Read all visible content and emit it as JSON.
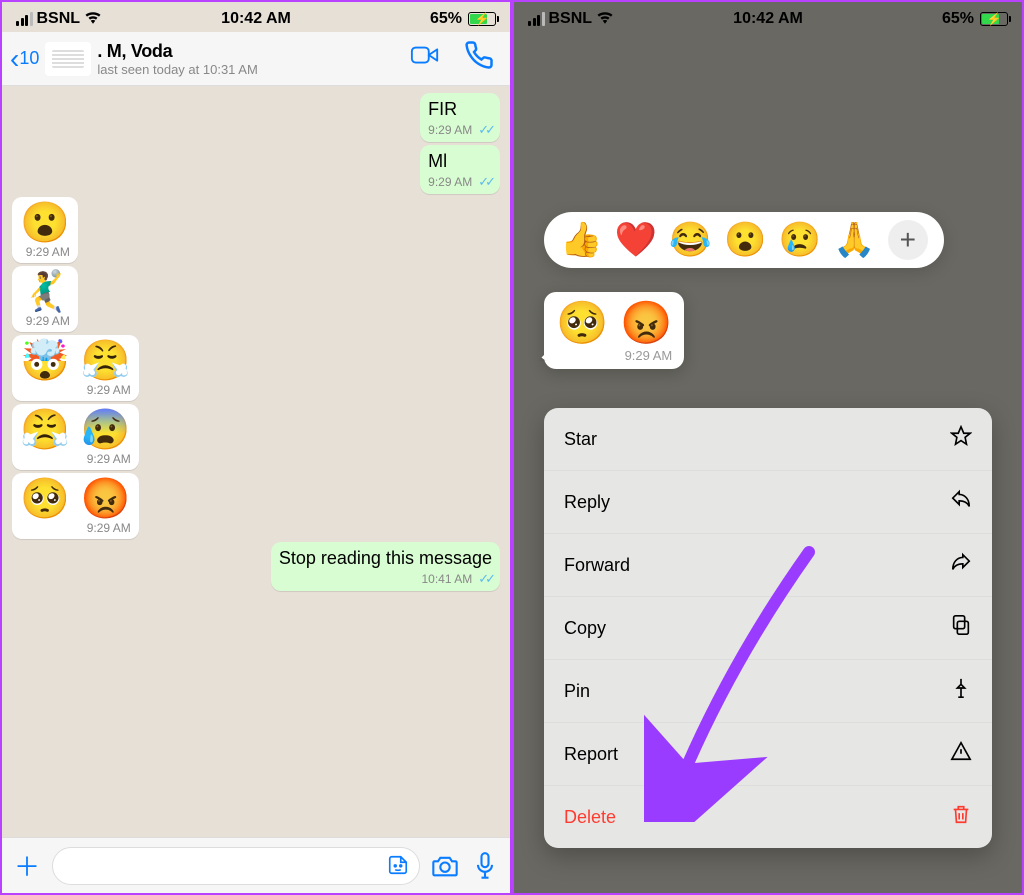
{
  "status": {
    "carrier": "BSNL",
    "time": "10:42 AM",
    "battery_pct": "65%"
  },
  "left": {
    "back_count": "10",
    "chat_name": ". M, Voda",
    "last_seen": "last seen today at 10:31 AM",
    "messages": [
      {
        "dir": "out",
        "text": "FIR",
        "time": "9:29 AM",
        "ticks": true,
        "type": "text"
      },
      {
        "dir": "out",
        "text": "Ml",
        "time": "9:29 AM",
        "ticks": true,
        "type": "text"
      },
      {
        "dir": "in",
        "emoji": "😮",
        "time": "9:29 AM",
        "type": "emoji"
      },
      {
        "dir": "in",
        "emoji": "🤾‍♂️",
        "time": "9:29 AM",
        "type": "emoji"
      },
      {
        "dir": "in",
        "emoji": "🤯 😤",
        "time": "9:29 AM",
        "type": "emoji"
      },
      {
        "dir": "in",
        "emoji": "😤 😰",
        "time": "9:29 AM",
        "type": "emoji"
      },
      {
        "dir": "in",
        "emoji": "🥺 😡",
        "time": "9:29 AM",
        "type": "emoji"
      },
      {
        "dir": "out",
        "text": "Stop reading this message",
        "time": "10:41 AM",
        "ticks": true,
        "type": "text"
      }
    ]
  },
  "right": {
    "reactions": [
      "👍",
      "❤️",
      "😂",
      "😮",
      "😢",
      "🙏"
    ],
    "selected": {
      "emoji": "🥺 😡",
      "time": "9:29 AM"
    },
    "menu": [
      {
        "label": "Star",
        "icon": "star"
      },
      {
        "label": "Reply",
        "icon": "reply"
      },
      {
        "label": "Forward",
        "icon": "forward"
      },
      {
        "label": "Copy",
        "icon": "copy"
      },
      {
        "label": "Pin",
        "icon": "pin"
      },
      {
        "label": "Report",
        "icon": "report"
      },
      {
        "label": "Delete",
        "icon": "trash",
        "danger": true
      }
    ]
  }
}
